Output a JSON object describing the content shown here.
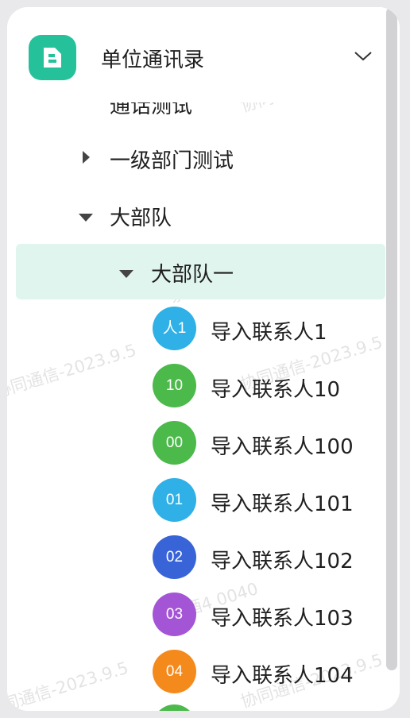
{
  "header": {
    "title": "单位通讯录",
    "app_icon": "contacts-book-icon",
    "expand_icon": "chevron-down-icon"
  },
  "tree": {
    "partial_label": "通话测试",
    "nodes": [
      {
        "label": "一级部门测试",
        "state": "collapsed"
      },
      {
        "label": "大部队",
        "state": "expanded"
      },
      {
        "label": "大部队一",
        "state": "expanded",
        "selected": true
      }
    ]
  },
  "contacts": [
    {
      "avatar": "人1",
      "name": "导入联系人1",
      "color": "#2fb0e6"
    },
    {
      "avatar": "10",
      "name": "导入联系人10",
      "color": "#4cb94b"
    },
    {
      "avatar": "00",
      "name": "导入联系人100",
      "color": "#4cb94b"
    },
    {
      "avatar": "01",
      "name": "导入联系人101",
      "color": "#2fb0e6"
    },
    {
      "avatar": "02",
      "name": "导入联系人102",
      "color": "#3864d8"
    },
    {
      "avatar": "03",
      "name": "导入联系人103",
      "color": "#a455d6"
    },
    {
      "avatar": "04",
      "name": "导入联系人104",
      "color": "#f58a1c"
    }
  ],
  "next_avatar_color": "#4cb94b",
  "watermarks": [
    "协同通信-2023.9.5",
    "蔡酒4 0040"
  ],
  "colors": {
    "accent": "#25c19a",
    "selected_row": "#e1f5ef"
  }
}
